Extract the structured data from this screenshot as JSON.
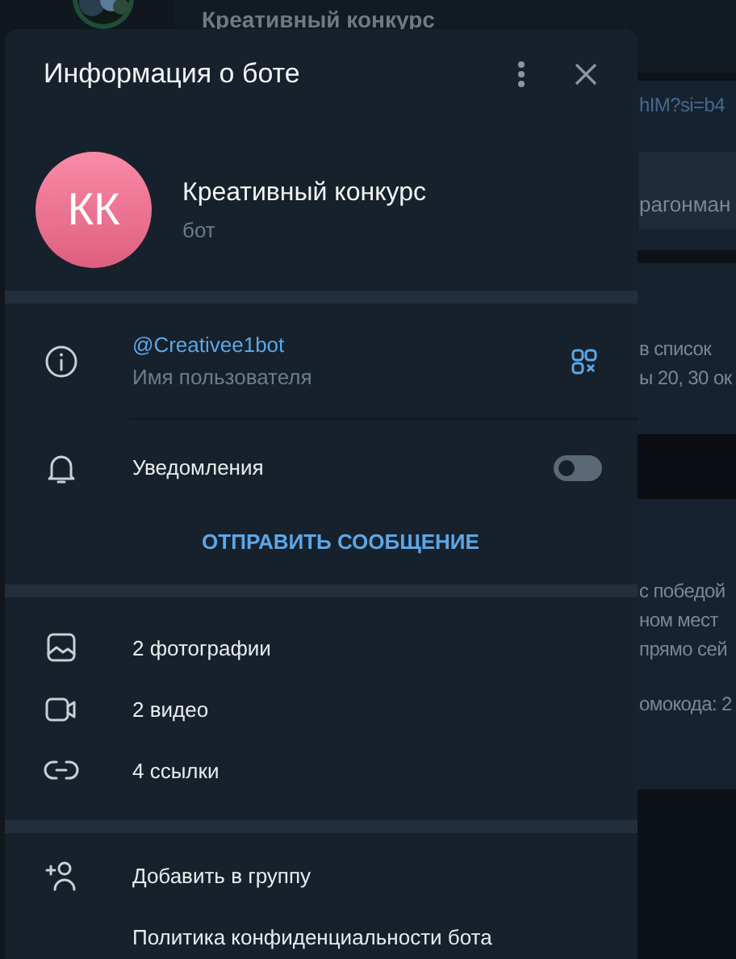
{
  "background": {
    "chat_title": "Креативный конкурс",
    "messages": [
      {
        "paragraphs": [
          [
            "hIM?si=b4"
          ]
        ],
        "button": "рагонман"
      },
      {
        "paragraphs": [
          [
            "в список",
            "ы 20, 30 ок"
          ]
        ]
      },
      {
        "paragraphs": [
          [
            "с победой",
            "ном мест",
            "прямо сей"
          ],
          [
            "омокода: 2"
          ]
        ]
      }
    ]
  },
  "dialog": {
    "title": "Информация о боте",
    "profile": {
      "initials": "КК",
      "name": "Креативный конкурс",
      "subtitle": "бот"
    },
    "sections": [
      {
        "rows": [
          {
            "kind": "info",
            "value": "@Creativee1bot",
            "label": "Имя пользователя"
          },
          {
            "kind": "toggle",
            "label": "Уведомления",
            "on": false
          },
          {
            "kind": "action",
            "label": "ОТПРАВИТЬ СООБЩЕНИЕ"
          }
        ]
      },
      {
        "rows": [
          {
            "kind": "item",
            "label": "2 фотографии"
          },
          {
            "kind": "item",
            "label": "2 видео"
          },
          {
            "kind": "item",
            "label": "4 ссылки"
          }
        ]
      },
      {
        "rows": [
          {
            "kind": "item",
            "label": "Добавить в группу"
          },
          {
            "kind": "item",
            "label": "Политика конфиденциальности бота"
          }
        ]
      }
    ]
  }
}
